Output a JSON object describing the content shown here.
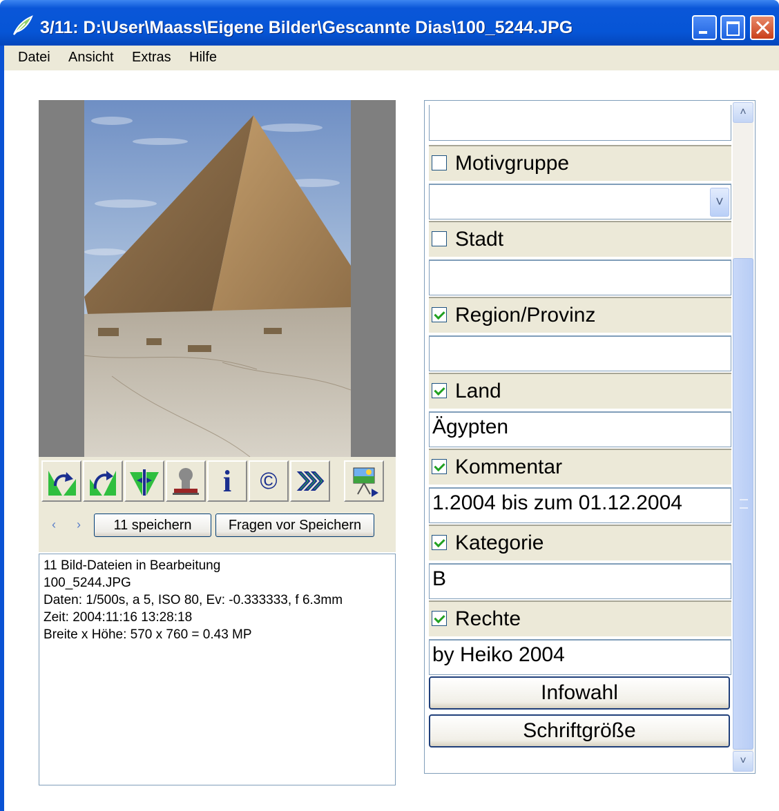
{
  "window": {
    "title": "3/11: D:\\User\\Maass\\Eigene Bilder\\Gescannte Dias\\100_5244.JPG"
  },
  "menu": [
    "Datei",
    "Ansicht",
    "Extras",
    "Hilfe"
  ],
  "toolbar": {
    "icons": [
      "rotate-left-icon",
      "rotate-right-icon",
      "flip-icon",
      "person-stamp-icon",
      "info-icon",
      "copyright-icon",
      "forward-icon",
      "slideshow-icon"
    ],
    "info_glyph": "i",
    "copyright_glyph": "©",
    "nav_prev": "‹",
    "nav_next": "›",
    "save_label": "11 speichern",
    "ask_label": "Fragen vor Speichern"
  },
  "info": {
    "lines": [
      "11 Bild-Dateien in Bearbeitung",
      "100_5244.JPG",
      "Daten: 1/500s, a 5, ISO 80, Ev: -0.333333, f 6.3mm",
      "Zeit: 2004:11:16 13:28:18",
      "Breite x Höhe: 570 x 760 = 0.43 MP"
    ]
  },
  "fields": [
    {
      "label": "Motivgruppe",
      "checked": false,
      "value": ""
    },
    {
      "label": "Stadt",
      "checked": false,
      "value": ""
    },
    {
      "label": "Region/Provinz",
      "checked": true,
      "value": ""
    },
    {
      "label": "Land",
      "checked": true,
      "value": "Ägypten"
    },
    {
      "label": "Kommentar",
      "checked": true,
      "value": "1.2004 bis zum 01.12.2004"
    },
    {
      "label": "Kategorie",
      "checked": true,
      "value": "B"
    },
    {
      "label": "Rechte",
      "checked": true,
      "value": "by Heiko 2004"
    }
  ],
  "buttons": {
    "infowahl": "Infowahl",
    "schriftgroesse": "Schriftgröße"
  },
  "scroll": {
    "up": "˄",
    "down": "˅",
    "combo": "˅"
  },
  "colors": {
    "accent": "#0655d6",
    "face": "#ece9d8",
    "check": "#21a121"
  }
}
